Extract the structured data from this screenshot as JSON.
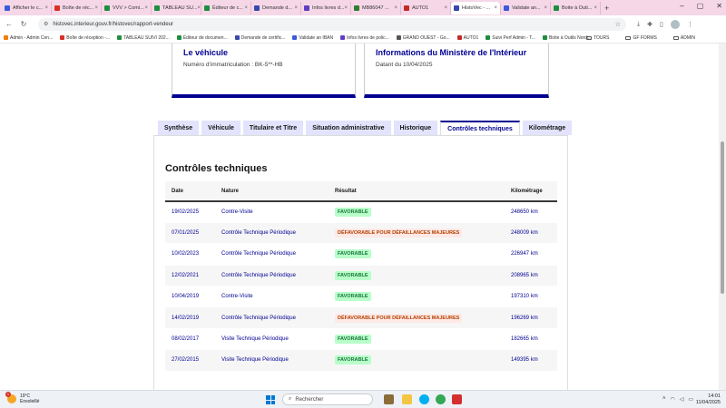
{
  "browser": {
    "tabs": [
      {
        "label": "Afficher le c...",
        "color": "#3b5bdb"
      },
      {
        "label": "Boîte de réc...",
        "color": "#d93025"
      },
      {
        "label": "VVV > Comi...",
        "color": "#1e8e3e"
      },
      {
        "label": "TABLEAU SU...",
        "color": "#1e8e3e"
      },
      {
        "label": "Éditeur de c...",
        "color": "#1e8e3e"
      },
      {
        "label": "Demande d...",
        "color": "#3949ab"
      },
      {
        "label": "Infos livres d...",
        "color": "#5f3dc4"
      },
      {
        "label": "MB86047 ...",
        "color": "#2e7d32"
      },
      {
        "label": "AUTO1",
        "color": "#c62828"
      },
      {
        "label": "HistoVec - ...",
        "color": "#3949ab"
      },
      {
        "label": "Validate an...",
        "color": "#3b5bdb"
      },
      {
        "label": "Boite à Outi...",
        "color": "#1e8e3e"
      }
    ],
    "active_tab_index": 9,
    "url": "histovec.interieur.gouv.fr/histovec/rapport-vendeur",
    "bookmarks": [
      {
        "label": "Admin - Admin Cen...",
        "color": "#f57c00"
      },
      {
        "label": "Boîte de réception -...",
        "color": "#d93025"
      },
      {
        "label": "TABLEAU SUIVI 202...",
        "color": "#1e8e3e"
      },
      {
        "label": "Éditeur de documen...",
        "color": "#1e8e3e"
      },
      {
        "label": "Demande de certific...",
        "color": "#3949ab"
      },
      {
        "label": "Validate an IBAN",
        "color": "#3b5bdb"
      },
      {
        "label": "Infos livres de polic...",
        "color": "#5f3dc4"
      },
      {
        "label": "GRAND OUEST - Go...",
        "color": "#555555"
      },
      {
        "label": "AUTO1",
        "color": "#c62828"
      },
      {
        "label": "Suivi Perf Admin - T...",
        "color": "#1e8e3e"
      },
      {
        "label": "Boite à Outils Nordi...",
        "color": "#1e8e3e"
      }
    ],
    "bookmark_folders": [
      "TOURS",
      "GF FORMS",
      "ADMIN"
    ]
  },
  "cards": {
    "vehicle_title": "Le véhicule",
    "vehicle_text": "Numéro d'immatriculation : BK-5**-HB",
    "ministry_title": "Informations du Ministère de l'Intérieur",
    "ministry_text": "Datant du 10/04/2025"
  },
  "page_tabs": [
    "Synthèse",
    "Véhicule",
    "Titulaire et Titre",
    "Situation administrative",
    "Historique",
    "Contrôles techniques",
    "Kilométrage"
  ],
  "active_page_tab": 5,
  "section_title": "Contrôles techniques",
  "table": {
    "headers": [
      "Date",
      "Nature",
      "Résultat",
      "Kilométrage"
    ],
    "rows": [
      {
        "date": "19/02/2025",
        "nature": "Contre-Visite",
        "result": "FAVORABLE",
        "status": "ok",
        "km": "248650 km"
      },
      {
        "date": "07/01/2025",
        "nature": "Contrôle Technique Périodique",
        "result": "DÉFAVORABLE POUR DÉFAILLANCES MAJEURES",
        "status": "ko",
        "km": "248009 km"
      },
      {
        "date": "10/02/2023",
        "nature": "Contrôle Technique Périodique",
        "result": "FAVORABLE",
        "status": "ok",
        "km": "226947 km"
      },
      {
        "date": "12/02/2021",
        "nature": "Contrôle Technique Périodique",
        "result": "FAVORABLE",
        "status": "ok",
        "km": "208965 km"
      },
      {
        "date": "10/04/2019",
        "nature": "Contre-Visite",
        "result": "FAVORABLE",
        "status": "ok",
        "km": "197310 km"
      },
      {
        "date": "14/02/2019",
        "nature": "Contrôle Technique Périodique",
        "result": "DÉFAVORABLE POUR DÉFAILLANCES MAJEURES",
        "status": "ko",
        "km": "196269 km"
      },
      {
        "date": "08/02/2017",
        "nature": "Visite Technique Périodique",
        "result": "FAVORABLE",
        "status": "ok",
        "km": "182665 km"
      },
      {
        "date": "27/02/2015",
        "nature": "Visite Technique Périodique",
        "result": "FAVORABLE",
        "status": "ok",
        "km": "149395 km"
      }
    ]
  },
  "taskbar": {
    "weather_temp": "19°C",
    "weather_desc": "Ensoleillé",
    "search_placeholder": "Rechercher",
    "time": "14:01",
    "date": "11/04/2025"
  }
}
